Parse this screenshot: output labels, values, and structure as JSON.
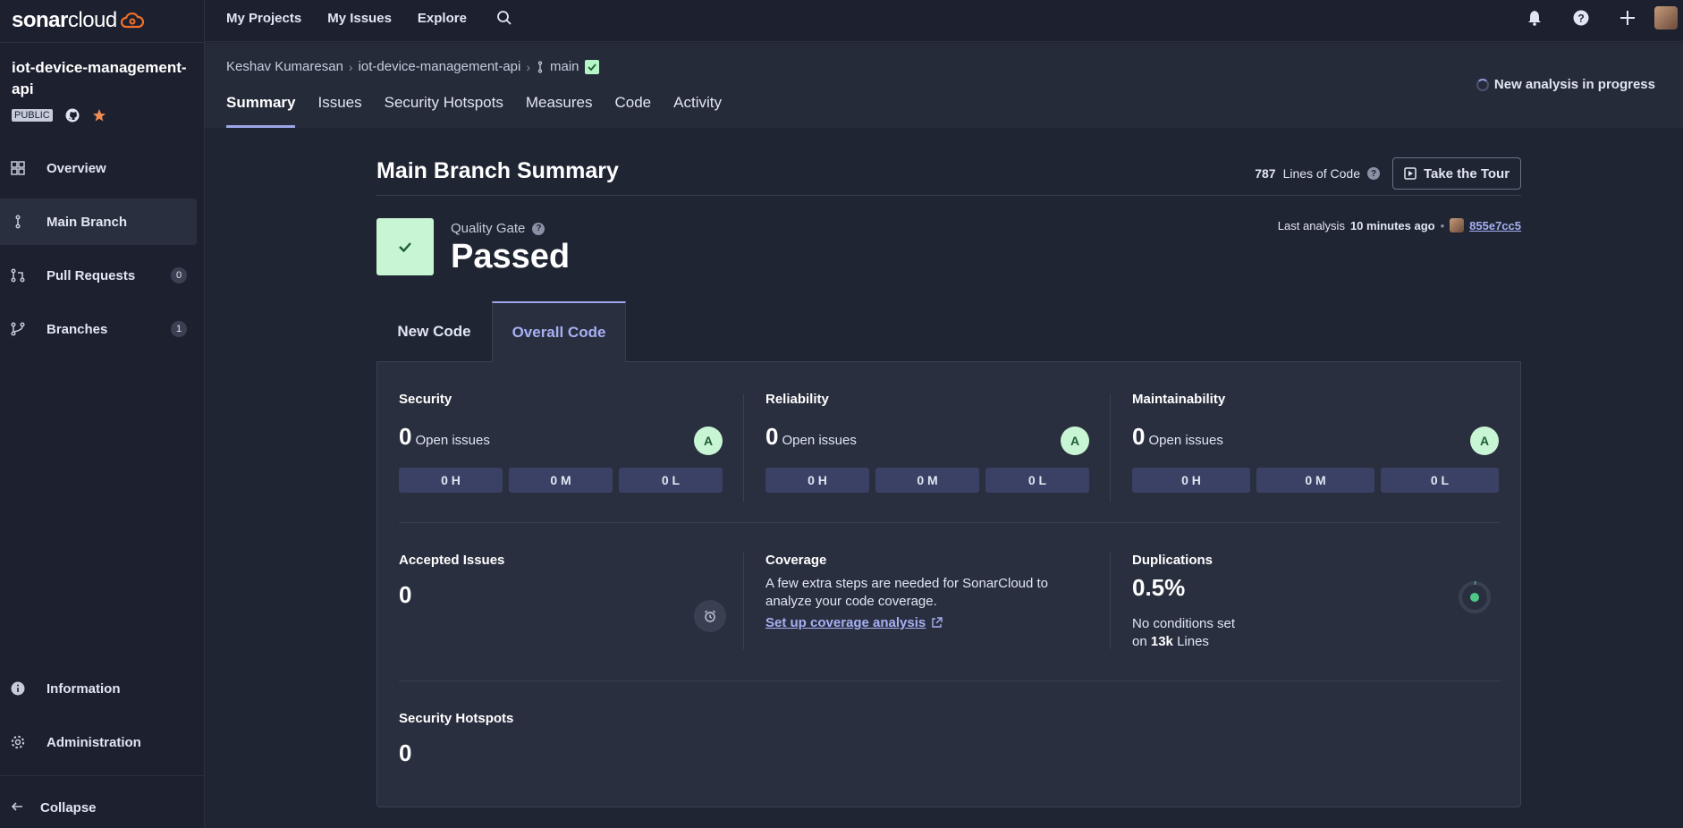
{
  "brand": {
    "name_bold": "sonar",
    "name_light": "cloud"
  },
  "project": {
    "name": "iot-device-management-api",
    "visibility": "PUBLIC"
  },
  "sidebar": {
    "items": [
      {
        "label": "Overview",
        "icon": "dashboard-icon"
      },
      {
        "label": "Main Branch",
        "icon": "branch-icon",
        "active": true
      },
      {
        "label": "Pull Requests",
        "icon": "pull-request-icon",
        "count": "0"
      },
      {
        "label": "Branches",
        "icon": "branches-icon",
        "count": "1"
      }
    ],
    "bottom_items": [
      {
        "label": "Information",
        "icon": "info-icon"
      },
      {
        "label": "Administration",
        "icon": "gear-icon"
      }
    ],
    "collapse_label": "Collapse"
  },
  "topnav": {
    "items": [
      "My Projects",
      "My Issues",
      "Explore"
    ]
  },
  "breadcrumb": {
    "owner": "Keshav Kumaresan",
    "project": "iot-device-management-api",
    "branch": "main"
  },
  "project_tabs": [
    "Summary",
    "Issues",
    "Security Hotspots",
    "Measures",
    "Code",
    "Activity"
  ],
  "analysis_status": "New analysis in progress",
  "summary": {
    "title": "Main Branch Summary",
    "loc_value": "787",
    "loc_label": "Lines of Code",
    "tour_label": "Take the Tour",
    "qg_label": "Quality Gate",
    "qg_status": "Passed",
    "last_analysis_prefix": "Last analysis",
    "last_analysis_time": "10 minutes ago",
    "commit": "855e7cc5"
  },
  "code_tabs": [
    "New Code",
    "Overall Code"
  ],
  "metrics": {
    "open_issues_label": "Open issues",
    "security": {
      "title": "Security",
      "value": "0",
      "grade": "A",
      "sev": [
        "0 H",
        "0 M",
        "0 L"
      ]
    },
    "reliability": {
      "title": "Reliability",
      "value": "0",
      "grade": "A",
      "sev": [
        "0 H",
        "0 M",
        "0 L"
      ]
    },
    "maintainability": {
      "title": "Maintainability",
      "value": "0",
      "grade": "A",
      "sev": [
        "0 H",
        "0 M",
        "0 L"
      ]
    },
    "accepted": {
      "title": "Accepted Issues",
      "value": "0"
    },
    "coverage": {
      "title": "Coverage",
      "text": "A few extra steps are needed for SonarCloud to analyze your code coverage.",
      "link": "Set up coverage analysis"
    },
    "duplications": {
      "title": "Duplications",
      "value": "0.5%",
      "line1": "No conditions set",
      "line2_prefix": "on",
      "line2_value": "13k",
      "line2_suffix": "Lines"
    },
    "hotspots": {
      "title": "Security Hotspots",
      "value": "0"
    }
  },
  "colors": {
    "accent": "#9da6e9",
    "pass_green": "#c8f5d4",
    "background": "#202533"
  }
}
